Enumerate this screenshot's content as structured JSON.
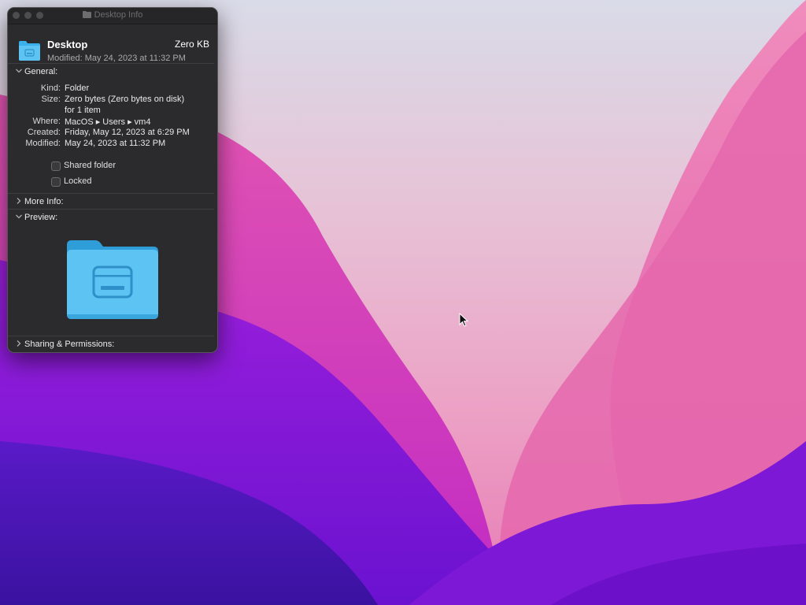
{
  "window": {
    "title": "Desktop Info",
    "header": {
      "name": "Desktop",
      "size": "Zero KB",
      "modified": "Modified: May 24, 2023 at 11:32 PM"
    },
    "general": {
      "heading": "General:",
      "rows": [
        {
          "label": "Kind:",
          "value": "Folder"
        },
        {
          "label": "Size:",
          "value": "Zero bytes (Zero bytes on disk)"
        },
        {
          "label": "",
          "value": "for 1 item"
        },
        {
          "label": "Where:",
          "value": "MacOS ▸ Users ▸ vm4"
        },
        {
          "label": "Created:",
          "value": "Friday, May 12, 2023 at 6:29 PM"
        },
        {
          "label": "Modified:",
          "value": "May 24, 2023 at 11:32 PM"
        }
      ],
      "shared_folder": {
        "label": "Shared folder",
        "checked": false
      },
      "locked": {
        "label": "Locked",
        "checked": false
      }
    },
    "more_info": {
      "heading": "More Info:"
    },
    "preview": {
      "heading": "Preview:"
    },
    "sharing": {
      "heading": "Sharing & Permissions:"
    }
  },
  "icons": {
    "close": "close-icon",
    "minimize": "minimize-icon",
    "zoom": "zoom-icon",
    "folder": "folder-icon",
    "chevron_down": "chevron-down-icon",
    "chevron_right": "chevron-right-icon",
    "cursor": "cursor-icon"
  },
  "colors": {
    "window_bg": "#2b2b2d",
    "folder_blue": "#3ab0ec",
    "wallpaper_purple": "#6a16c8",
    "wallpaper_pink": "#d93aa6"
  }
}
